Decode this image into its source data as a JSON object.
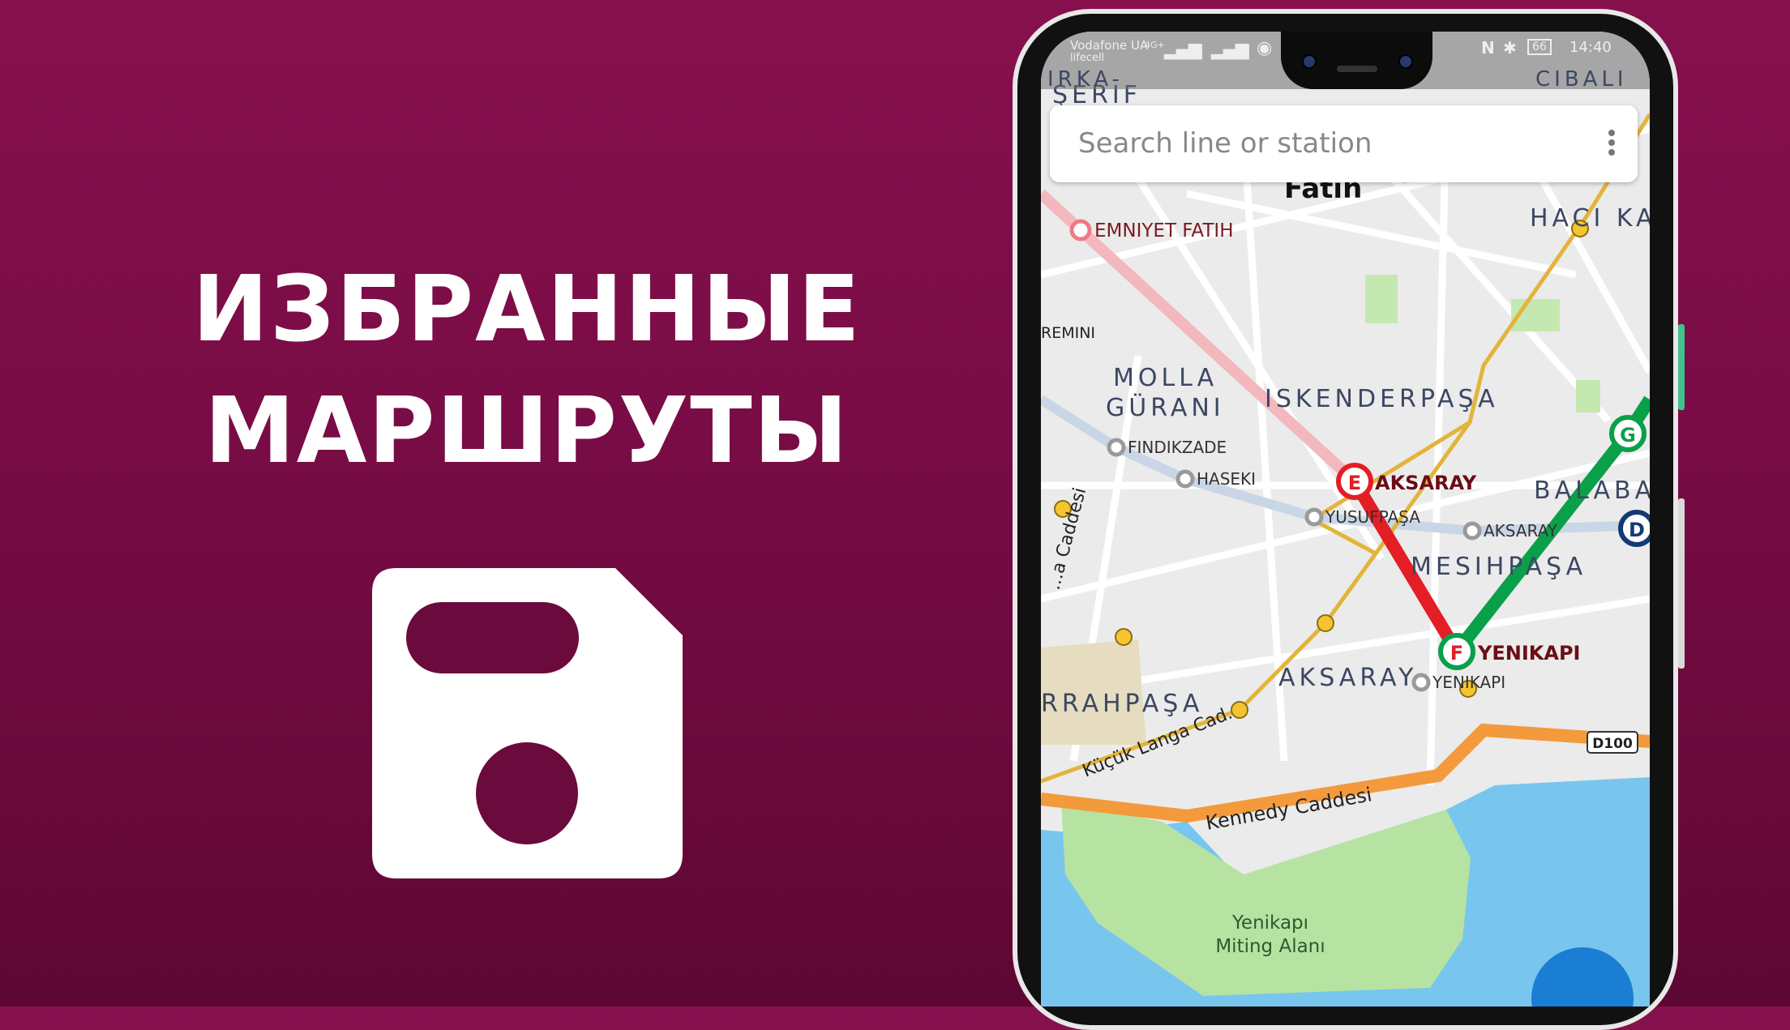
{
  "promo": {
    "title_line1": "ИЗБРАННЫЕ",
    "title_line2": "МАРШРУТЫ",
    "icon": "floppy-save-icon"
  },
  "colors": {
    "background": "#7a0c46",
    "line_e": "#e31e24",
    "line_f_g": "#0aa04a",
    "line_tram": "#e2b53a",
    "line_metro": "#c9d6e6",
    "line_pink": "#f2b8bd",
    "water": "#78c6ee",
    "park": "#b6e3a2"
  },
  "status_bar": {
    "carrier1": "Vodafone UA",
    "network": "4G+",
    "carrier2": "lifecell",
    "battery": "66",
    "time": "14:40"
  },
  "search": {
    "placeholder": "Search line or station",
    "menu_icon": "more-vert-icon"
  },
  "map": {
    "stations": {
      "e_badge": "E",
      "e_name": "AKSARAY",
      "f_badge": "F",
      "f_name": "YENIKAPI",
      "g_badge": "G",
      "d_badge": "D",
      "emniyet": "EMNIYET FATIH",
      "findikzade": "FINDIKZADE",
      "haseki": "HASEKI",
      "yusufpasa": "YUSUFPAŞA",
      "aksaray_small": "AKSARAY",
      "yenikapi_small": "YENIKAPI"
    },
    "labels": {
      "irka": "IRKA-",
      "serif": "ŞERIF",
      "cibali": "CIBALI",
      "fatih": "Fatih",
      "haci": "HACI KA",
      "remini": "REMINI",
      "molla": "MOLLA",
      "gurani": "GÜRANI",
      "iskenderpasa": "ISKENDERPAŞA",
      "balaba": "BALABA",
      "mesihpasa": "MESIHPAŞA",
      "aksaray_district": "AKSARAY",
      "rrahpasa": "RRAHPAŞA",
      "kucuk_langa": "Küçük Langa Cad.",
      "caddesi": "...a Caddesi",
      "kennedy": "Kennedy Caddesi",
      "d100": "D100",
      "miting1": "Yenikapı",
      "miting2": "Miting Alanı"
    }
  }
}
